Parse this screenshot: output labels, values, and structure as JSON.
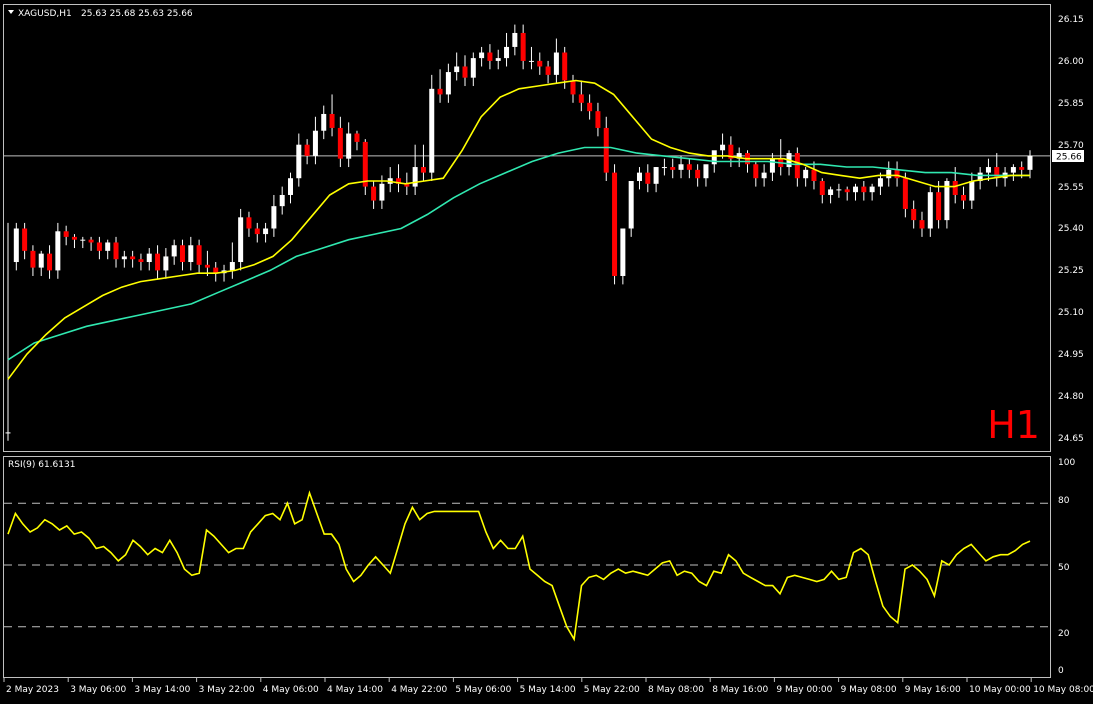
{
  "header": {
    "symbol_label": "XAGUSD,H1",
    "ohlc_label": "25.63 25.68 25.63 25.66"
  },
  "watermark": "H1",
  "current_price_label": "25.66",
  "colors": {
    "background": "#000000",
    "bull_body": "#ffffff",
    "bear_body": "#ff0000",
    "wick": "#ffffff",
    "ma_fast": "#ffff00",
    "ma_slow": "#30e8b0",
    "rsi": "#ffff00",
    "watermark": "#ff0000",
    "frame": "#c0c0c0"
  },
  "chart_data": [
    {
      "type": "candlestick",
      "title": "XAGUSD,H1",
      "price_ticks": [
        "26.15",
        "26.00",
        "25.85",
        "25.70",
        "25.55",
        "25.40",
        "25.25",
        "25.10",
        "24.95",
        "24.80",
        "24.65"
      ],
      "ylim": [
        24.62,
        26.2
      ],
      "x_tick_labels": [
        "2 May 2023",
        "3 May 06:00",
        "3 May 14:00",
        "3 May 22:00",
        "4 May 06:00",
        "4 May 14:00",
        "4 May 22:00",
        "5 May 06:00",
        "5 May 14:00",
        "5 May 22:00",
        "8 May 08:00",
        "8 May 16:00",
        "9 May 00:00",
        "9 May 08:00",
        "9 May 16:00",
        "10 May 00:00",
        "10 May 08:00"
      ],
      "current_price": 25.66,
      "candles_ohc": [
        [
          24.67,
          25.42,
          24.67
        ],
        [
          25.28,
          25.42,
          25.4
        ],
        [
          25.4,
          25.42,
          25.32
        ],
        [
          25.32,
          25.34,
          25.26
        ],
        [
          25.26,
          25.32,
          25.31
        ],
        [
          25.31,
          25.34,
          25.25
        ],
        [
          25.25,
          25.42,
          25.39
        ],
        [
          25.39,
          25.41,
          25.37
        ],
        [
          25.37,
          25.38,
          25.36
        ],
        [
          25.36,
          25.37,
          25.36
        ],
        [
          25.36,
          25.37,
          25.35
        ],
        [
          25.35,
          25.37,
          25.32
        ],
        [
          25.32,
          25.36,
          25.35
        ],
        [
          25.35,
          25.37,
          25.29
        ],
        [
          25.29,
          25.32,
          25.3
        ],
        [
          25.3,
          25.32,
          25.29
        ],
        [
          25.29,
          25.31,
          25.28
        ],
        [
          25.28,
          25.33,
          25.31
        ],
        [
          25.31,
          25.34,
          25.25
        ],
        [
          25.25,
          25.33,
          25.3
        ],
        [
          25.3,
          25.36,
          25.34
        ],
        [
          25.34,
          25.36,
          25.28
        ],
        [
          25.28,
          25.37,
          25.34
        ],
        [
          25.34,
          25.36,
          25.27
        ],
        [
          25.27,
          25.32,
          25.26
        ],
        [
          25.26,
          25.28,
          25.24
        ],
        [
          25.24,
          25.27,
          25.25
        ],
        [
          25.25,
          25.35,
          25.28
        ],
        [
          25.28,
          25.47,
          25.44
        ],
        [
          25.44,
          25.46,
          25.4
        ],
        [
          25.4,
          25.42,
          25.38
        ],
        [
          25.38,
          25.42,
          25.4
        ],
        [
          25.4,
          25.52,
          25.48
        ],
        [
          25.48,
          25.55,
          25.52
        ],
        [
          25.52,
          25.6,
          25.58
        ],
        [
          25.58,
          25.74,
          25.7
        ],
        [
          25.7,
          25.72,
          25.66
        ],
        [
          25.66,
          25.8,
          25.75
        ],
        [
          25.75,
          25.84,
          25.81
        ],
        [
          25.81,
          25.88,
          25.76
        ],
        [
          25.76,
          25.8,
          25.65
        ],
        [
          25.65,
          25.78,
          25.74
        ],
        [
          25.74,
          25.75,
          25.71
        ],
        [
          25.71,
          25.72,
          25.55
        ],
        [
          25.55,
          25.57,
          25.5
        ],
        [
          25.5,
          25.59,
          25.56
        ],
        [
          25.56,
          25.62,
          25.58
        ],
        [
          25.58,
          25.63,
          25.56
        ],
        [
          25.56,
          25.6,
          25.55
        ],
        [
          25.55,
          25.7,
          25.62
        ],
        [
          25.62,
          25.7,
          25.6
        ],
        [
          25.6,
          25.95,
          25.9
        ],
        [
          25.9,
          25.97,
          25.88
        ],
        [
          25.88,
          25.99,
          25.96
        ],
        [
          25.96,
          26.03,
          25.98
        ],
        [
          25.98,
          26.02,
          25.94
        ],
        [
          25.94,
          26.03,
          26.01
        ],
        [
          26.01,
          26.05,
          26.03
        ],
        [
          26.03,
          26.06,
          26.0
        ],
        [
          26.0,
          26.04,
          26.01
        ],
        [
          26.01,
          26.1,
          26.05
        ],
        [
          26.05,
          26.13,
          26.1
        ],
        [
          26.1,
          26.13,
          26.0
        ],
        [
          26.0,
          26.05,
          26.0
        ],
        [
          26.0,
          26.03,
          25.98
        ],
        [
          25.98,
          26.0,
          25.95
        ],
        [
          25.95,
          26.08,
          26.03
        ],
        [
          26.03,
          26.05,
          25.93
        ],
        [
          25.93,
          25.95,
          25.88
        ],
        [
          25.88,
          25.93,
          25.85
        ],
        [
          25.85,
          25.88,
          25.82
        ],
        [
          25.82,
          25.85,
          25.76
        ],
        [
          25.76,
          25.8,
          25.6
        ],
        [
          25.6,
          25.63,
          25.23
        ],
        [
          25.23,
          25.3,
          25.4
        ],
        [
          25.4,
          25.5,
          25.57
        ],
        [
          25.57,
          25.62,
          25.6
        ],
        [
          25.6,
          25.63,
          25.56
        ],
        [
          25.56,
          25.62,
          25.62
        ],
        [
          25.62,
          25.65,
          25.62
        ],
        [
          25.62,
          25.65,
          25.61
        ],
        [
          25.61,
          25.66,
          25.63
        ],
        [
          25.63,
          25.65,
          25.61
        ],
        [
          25.61,
          25.63,
          25.58
        ],
        [
          25.58,
          25.62,
          25.63
        ],
        [
          25.63,
          25.67,
          25.68
        ],
        [
          25.68,
          25.74,
          25.7
        ],
        [
          25.7,
          25.73,
          25.65
        ],
        [
          25.65,
          25.69,
          25.67
        ],
        [
          25.67,
          25.68,
          25.63
        ],
        [
          25.63,
          25.64,
          25.58
        ],
        [
          25.58,
          25.63,
          25.6
        ],
        [
          25.6,
          25.67,
          25.65
        ],
        [
          25.65,
          25.72,
          25.62
        ],
        [
          25.62,
          25.68,
          25.67
        ],
        [
          25.67,
          25.69,
          25.58
        ],
        [
          25.58,
          25.62,
          25.61
        ],
        [
          25.61,
          25.64,
          25.57
        ],
        [
          25.57,
          25.58,
          25.52
        ],
        [
          25.52,
          25.55,
          25.54
        ],
        [
          25.54,
          25.56,
          25.54
        ],
        [
          25.54,
          25.55,
          25.53
        ],
        [
          25.53,
          25.56,
          25.55
        ],
        [
          25.55,
          25.57,
          25.53
        ],
        [
          25.53,
          25.56,
          25.55
        ],
        [
          25.55,
          25.6,
          25.58
        ],
        [
          25.58,
          25.64,
          25.61
        ],
        [
          25.61,
          25.64,
          25.58
        ],
        [
          25.58,
          25.6,
          25.47
        ],
        [
          25.47,
          25.5,
          25.43
        ],
        [
          25.43,
          25.46,
          25.4
        ],
        [
          25.4,
          25.55,
          25.53
        ],
        [
          25.53,
          25.57,
          25.43
        ],
        [
          25.43,
          25.58,
          25.57
        ],
        [
          25.57,
          25.62,
          25.52
        ],
        [
          25.52,
          25.55,
          25.5
        ],
        [
          25.5,
          25.6,
          25.57
        ],
        [
          25.57,
          25.62,
          25.6
        ],
        [
          25.6,
          25.65,
          25.62
        ],
        [
          25.62,
          25.67,
          25.58
        ],
        [
          25.58,
          25.62,
          25.6
        ],
        [
          25.6,
          25.63,
          25.62
        ],
        [
          25.62,
          25.64,
          25.61
        ],
        [
          25.61,
          25.68,
          25.66
        ]
      ],
      "ma_fast": [
        24.86,
        24.95,
        25.02,
        25.08,
        25.12,
        25.16,
        25.19,
        25.21,
        25.22,
        25.23,
        25.24,
        25.24,
        25.25,
        25.27,
        25.3,
        25.36,
        25.44,
        25.52,
        25.56,
        25.57,
        25.57,
        25.56,
        25.57,
        25.58,
        25.68,
        25.8,
        25.87,
        25.9,
        25.91,
        25.92,
        25.93,
        25.92,
        25.88,
        25.8,
        25.72,
        25.69,
        25.67,
        25.66,
        25.66,
        25.65,
        25.65,
        25.65,
        25.63,
        25.6,
        25.59,
        25.58,
        25.59,
        25.59,
        25.57,
        25.55,
        25.55,
        25.57,
        25.58,
        25.59,
        25.59
      ],
      "ma_slow": [
        24.93,
        24.99,
        25.02,
        25.05,
        25.07,
        25.09,
        25.11,
        25.13,
        25.17,
        25.21,
        25.25,
        25.3,
        25.33,
        25.36,
        25.38,
        25.4,
        25.45,
        25.51,
        25.56,
        25.6,
        25.64,
        25.67,
        25.69,
        25.69,
        25.67,
        25.66,
        25.65,
        25.64,
        25.64,
        25.64,
        25.63,
        25.63,
        25.62,
        25.62,
        25.61,
        25.6,
        25.6,
        25.59,
        25.59,
        25.59
      ]
    },
    {
      "type": "line",
      "title": "RSI(9) 61.6131",
      "series": [
        {
          "name": "RSI(9)",
          "values": [
            65,
            75,
            70,
            66,
            68,
            72,
            70,
            67,
            69,
            65,
            66,
            63,
            58,
            59,
            56,
            52,
            55,
            62,
            59,
            55,
            58,
            56,
            62,
            56,
            48,
            45,
            46,
            67,
            64,
            60,
            56,
            58,
            58,
            66,
            70,
            74,
            75,
            72,
            80,
            70,
            72,
            85,
            75,
            65,
            65,
            60,
            48,
            42,
            45,
            50,
            54,
            50,
            46,
            58,
            70,
            78,
            72,
            75,
            76,
            76,
            76,
            76,
            76,
            76,
            76,
            66,
            58,
            62,
            58,
            58,
            64,
            48,
            45,
            42,
            40,
            30,
            20,
            14,
            40,
            44,
            45,
            43,
            46,
            48,
            46,
            47,
            46,
            45,
            48,
            51,
            52,
            45,
            47,
            46,
            42,
            40,
            47,
            46,
            55,
            52,
            46,
            44,
            42,
            40,
            40,
            36,
            44,
            45,
            44,
            43,
            42,
            43,
            47,
            43,
            44,
            56,
            58,
            55,
            42,
            30,
            25,
            22,
            48,
            50,
            47,
            43,
            35,
            52,
            50,
            55,
            58,
            60,
            56,
            52,
            54,
            55,
            55,
            57,
            60,
            61.6
          ]
        }
      ],
      "y_ticks": [
        "100",
        "80",
        "50",
        "20",
        "0"
      ],
      "ylim": [
        0,
        100
      ],
      "levels": [
        80,
        50,
        20
      ]
    }
  ]
}
